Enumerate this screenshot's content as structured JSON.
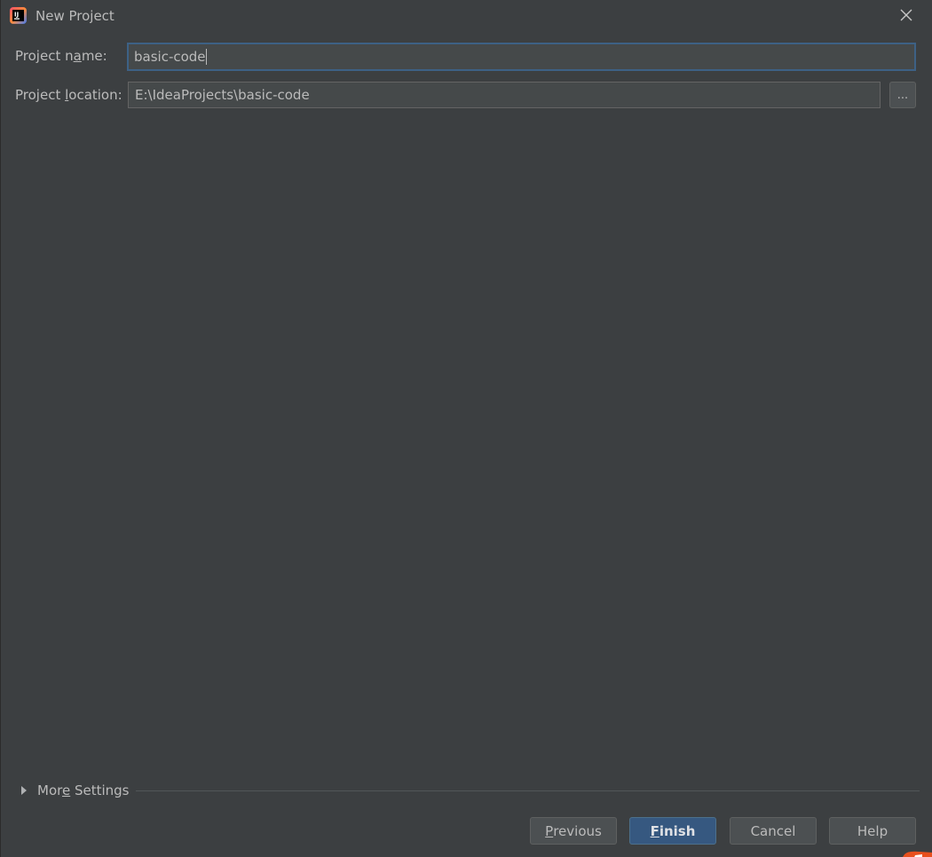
{
  "window": {
    "title": "New Project",
    "app_icon": "intellij-icon",
    "close_icon": "close-icon"
  },
  "form": {
    "project_name": {
      "label_before": "Project n",
      "label_mnemonic": "a",
      "label_after": "me:",
      "value": "basic-code"
    },
    "project_location": {
      "label_before": "Project ",
      "label_mnemonic": "l",
      "label_after": "ocation:",
      "value": "E:\\IdeaProjects\\basic-code",
      "browse_label": "..."
    }
  },
  "more_settings": {
    "label_before": "Mor",
    "label_mnemonic": "e",
    "label_after": " Settings",
    "icon": "expand-arrow-icon"
  },
  "buttons": {
    "previous": {
      "mnemonic": "P",
      "rest": "revious"
    },
    "finish": {
      "mnemonic": "F",
      "rest": "inish"
    },
    "cancel": "Cancel",
    "help": "Help"
  },
  "colors": {
    "background": "#3c3f41",
    "field_background": "#45494a",
    "focus_border": "#3d6185",
    "primary_button": "#365880",
    "text": "#bbbbbb"
  }
}
